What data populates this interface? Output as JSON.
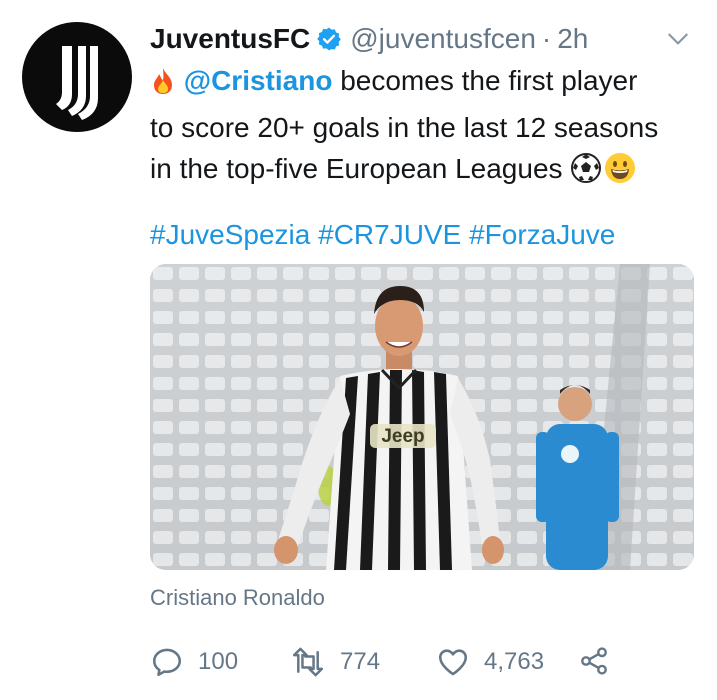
{
  "tweet": {
    "display_name": "JuventusFC",
    "handle": "@juventusfcen",
    "separator": "·",
    "time": "2h",
    "mention": "@Cristiano",
    "text_part1": " becomes the first player",
    "text_part2": "to score 20+ goals in the last 12 seasons",
    "text_part3": "in the top-five European Leagues ",
    "hashtags": [
      "#JuveSpezia",
      "#CR7JUVE",
      "#ForzaJuve"
    ],
    "media_caption": "Cristiano Ronaldo"
  },
  "media": {
    "jersey_text": "Jeep"
  },
  "actions": {
    "replies": "100",
    "retweets": "774",
    "likes": "4,763"
  },
  "colors": {
    "link": "#1b95e0",
    "muted": "#657786",
    "verified": "#1da1f2"
  },
  "icons": [
    "juventus-logo-icon",
    "verified-badge-icon",
    "chevron-down-icon",
    "fire-icon",
    "soccer-ball-icon",
    "grinning-face-icon",
    "reply-icon",
    "retweet-icon",
    "like-icon",
    "share-icon"
  ]
}
